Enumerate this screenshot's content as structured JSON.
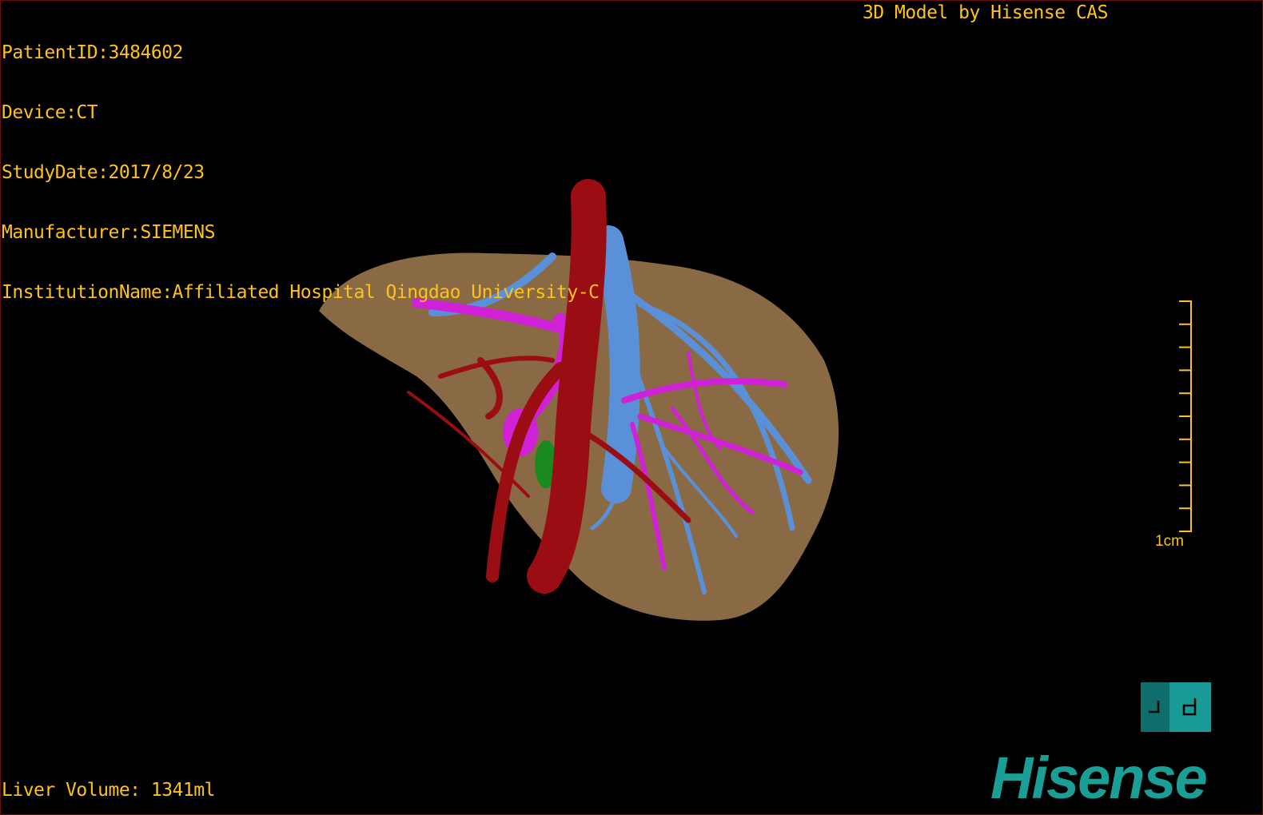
{
  "overlay": {
    "patient_id": "PatientID:3484602",
    "device": "Device:CT",
    "study_date": "StudyDate:2017/8/23",
    "manufacturer": "Manufacturer:SIEMENS",
    "institution": "InstitutionName:Affiliated Hospital Qingdao University-C",
    "model_credit": "3D Model by Hisense CAS",
    "liver_volume": "Liver Volume: 1341ml"
  },
  "ruler": {
    "label": "1cm",
    "ticks": 11
  },
  "view_toggle": {
    "icon": "layout-toggle-icon"
  },
  "logo": {
    "text": "Hisense"
  },
  "colors": {
    "overlay_text": "#ffc21a",
    "liver": "#8a6a45",
    "artery": "#9a0d12",
    "portal_vein": "#d020d8",
    "hepatic_vein": "#5a90d8",
    "gallbladder": "#1a8a20",
    "brand": "#1a9e95"
  }
}
